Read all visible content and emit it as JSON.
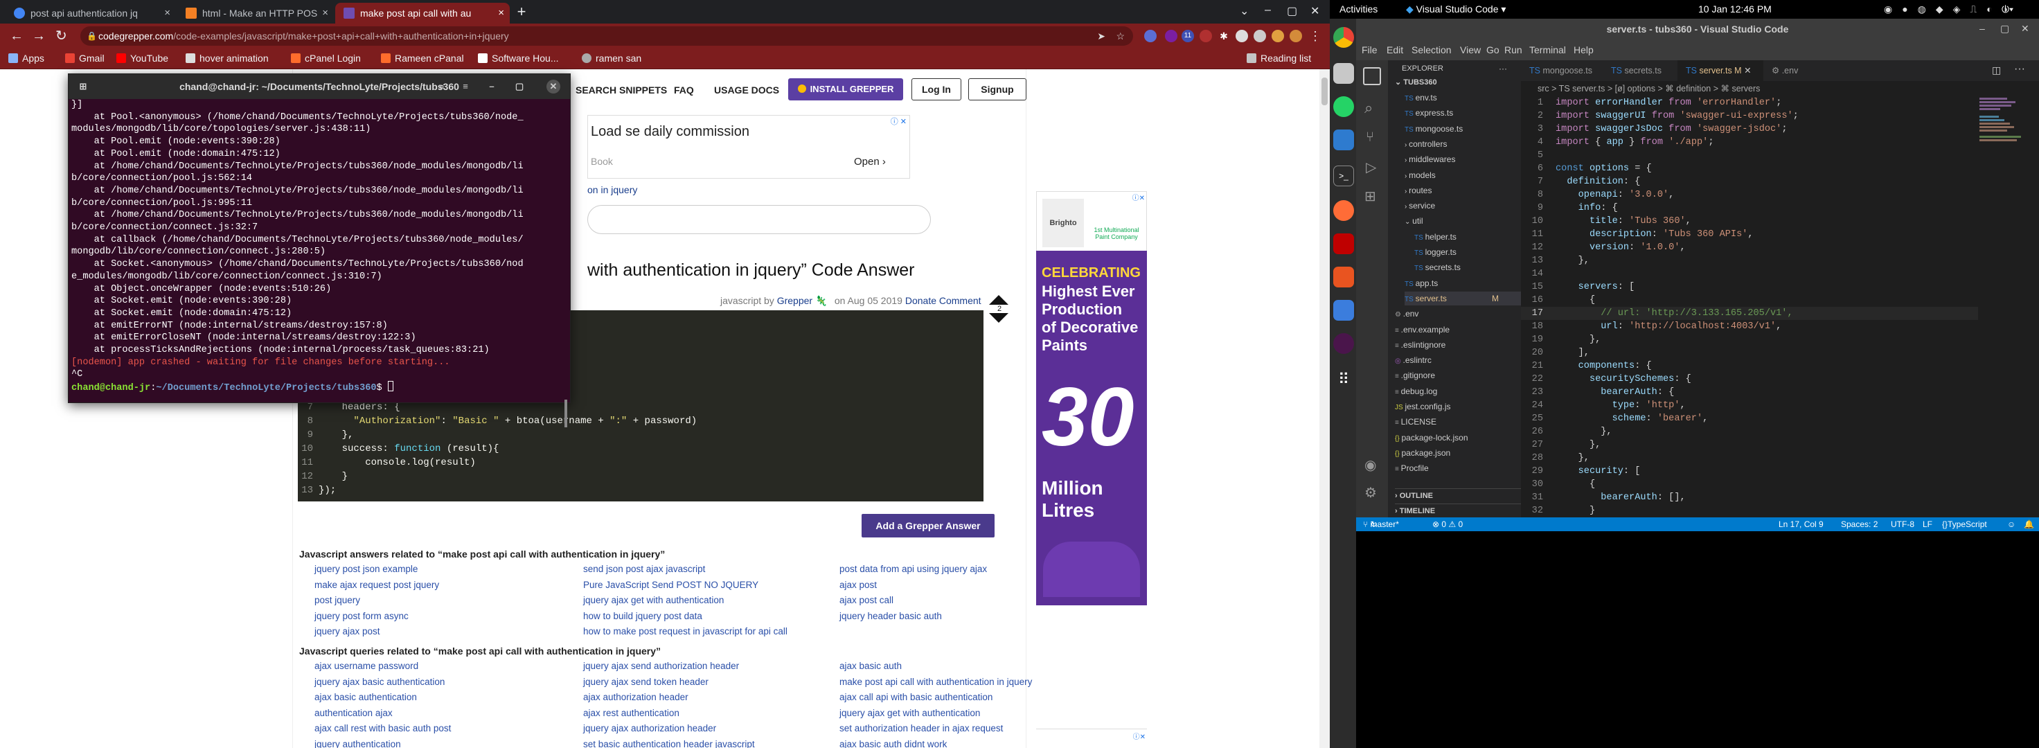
{
  "browser": {
    "tabs": [
      {
        "label": "post api authentication jq"
      },
      {
        "label": "html - Make an HTTP POS"
      },
      {
        "label": "make post api call with au"
      }
    ],
    "url_host": "codegrepper.com",
    "url_path": "/code-examples/javascript/make+post+api+call+with+authentication+in+jquery",
    "bookmarks": [
      "Apps",
      "Gmail",
      "YouTube",
      "hover animation",
      "cPanel Login",
      "Rameen cPanal",
      "Software Hou...",
      "ramen san"
    ],
    "reading_list": "Reading list",
    "ext_badge": "11"
  },
  "page": {
    "nav": [
      "SEARCH SNIPPETS",
      "FAQ",
      "USAGE DOCS"
    ],
    "install_btn": "INSTALL GREPPER",
    "login_btn": "Log In",
    "signup_btn": "Signup",
    "ad_headline": "Load se daily commission",
    "ad_source": "Book",
    "ad_open": "Open",
    "breadcrumb_tail": "on in jquery",
    "answer_title": "with authentication in jquery” Code Answer",
    "meta_prefix": "javascript by",
    "meta_author": "Grepper",
    "meta_date": "on Aug 05 2019",
    "meta_donate": "Donate Comment",
    "vote_count": "2",
    "code_lines": [
      {
        "n": "7",
        "parts": [
          {
            "t": "    headers: {",
            "c": "p"
          }
        ]
      },
      {
        "n": "8",
        "parts": [
          {
            "t": "      ",
            "c": "p"
          },
          {
            "t": "\"Authorization\"",
            "c": "s"
          },
          {
            "t": ": ",
            "c": "p"
          },
          {
            "t": "\"Basic \"",
            "c": "s"
          },
          {
            "t": " + btoa(username + ",
            "c": "p"
          },
          {
            "t": "\":\"",
            "c": "s"
          },
          {
            "t": " + password)",
            "c": "p"
          }
        ]
      },
      {
        "n": "9",
        "parts": [
          {
            "t": "    },",
            "c": "p"
          }
        ]
      },
      {
        "n": "10",
        "parts": [
          {
            "t": "    success: ",
            "c": "p"
          },
          {
            "t": "function",
            "c": "k"
          },
          {
            "t": " (result){",
            "c": "p"
          }
        ]
      },
      {
        "n": "11",
        "parts": [
          {
            "t": "        console.log(result)",
            "c": "p"
          }
        ]
      },
      {
        "n": "12",
        "parts": [
          {
            "t": "    }",
            "c": "p"
          }
        ]
      },
      {
        "n": "13",
        "parts": [
          {
            "t": "});",
            "c": "p"
          }
        ]
      }
    ],
    "add_answer_btn": "Add a Grepper Answer",
    "answers_title": "Javascript answers related to “make post api call with authentication in jquery”",
    "answers": [
      [
        "jquery post json example",
        "send json post ajax javascript",
        "post data from api using jquery ajax"
      ],
      [
        "make ajax request post jquery",
        "Pure JavaScript Send POST NO JQUERY",
        "ajax post"
      ],
      [
        "post jquery",
        "jquery ajax get with authentication",
        "ajax post call"
      ],
      [
        "jquery post form async",
        "how to build jquery post data",
        "jquery header basic auth"
      ],
      [
        "jquery ajax post",
        "how to make post request in javascript for api call",
        ""
      ]
    ],
    "queries_title": "Javascript queries related to “make post api call with authentication in jquery”",
    "queries": [
      [
        "ajax username password",
        "jquery ajax send authorization header",
        "ajax basic auth"
      ],
      [
        "jquery ajax basic authentication",
        "jquery ajax send token header",
        "make post api call with authentication in jquery"
      ],
      [
        "ajax basic authentication",
        "ajax authorization header",
        "ajax call api with basic authentication"
      ],
      [
        "authentication ajax",
        "ajax rest authentication",
        "jquery ajax get with authentication"
      ],
      [
        "ajax call rest with basic auth post",
        "jquery ajax authorization header",
        "set authorization header in ajax request"
      ],
      [
        "jquery authentication",
        "set basic authentication header javascript",
        "ajax basic auth didnt work"
      ]
    ],
    "side_ad_text": "Brighto",
    "side_ad_badge": "1st Multinational Paint Company",
    "big_ad_lines": [
      "CELEBRATING",
      "Highest Ever",
      "Production",
      "of Decorative",
      "Paints",
      "30",
      "Million",
      "Litres"
    ]
  },
  "terminal": {
    "title": "chand@chand-jr: ~/Documents/TechnoLyte/Projects/tubs360",
    "lines": [
      "}]",
      "    at Pool.<anonymous> (/home/chand/Documents/TechnoLyte/Projects/tubs360/node_",
      "modules/mongodb/lib/core/topologies/server.js:438:11)",
      "    at Pool.emit (node:events:390:28)",
      "    at Pool.emit (node:domain:475:12)",
      "    at /home/chand/Documents/TechnoLyte/Projects/tubs360/node_modules/mongodb/li",
      "b/core/connection/pool.js:562:14",
      "    at /home/chand/Documents/TechnoLyte/Projects/tubs360/node_modules/mongodb/li",
      "b/core/connection/pool.js:995:11",
      "    at /home/chand/Documents/TechnoLyte/Projects/tubs360/node_modules/mongodb/li",
      "b/core/connection/connect.js:32:7",
      "    at callback (/home/chand/Documents/TechnoLyte/Projects/tubs360/node_modules/",
      "mongodb/lib/core/connection/connect.js:280:5)",
      "    at Socket.<anonymous> (/home/chand/Documents/TechnoLyte/Projects/tubs360/nod",
      "e_modules/mongodb/lib/core/connection/connect.js:310:7)",
      "    at Object.onceWrapper (node:events:510:26)",
      "    at Socket.emit (node:events:390:28)",
      "    at Socket.emit (node:domain:475:12)",
      "    at emitErrorNT (node:internal/streams/destroy:157:8)",
      "    at emitErrorCloseNT (node:internal/streams/destroy:122:3)",
      "    at processTicksAndRejections (node:internal/process/task_queues:83:21)"
    ],
    "crash_line": "[nodemon] app crashed - waiting for file changes before starting...",
    "ctrl_c": "^C",
    "prompt_user": "chand@chand-jr",
    "prompt_path": "~/Documents/TechnoLyte/Projects/tubs360",
    "prompt_sym": "$ "
  },
  "ubuntu": {
    "activities": "Activities",
    "app_name": "Visual Studio Code",
    "clock": "10 Jan  12:46 PM"
  },
  "vscode": {
    "title": "server.ts - tubs360 - Visual Studio Code",
    "menu": [
      "File",
      "Edit",
      "Selection",
      "View",
      "Go",
      "Run",
      "Terminal",
      "Help"
    ],
    "explorer_label": "EXPLORER",
    "root": "TUBS360",
    "tree": [
      {
        "label": "env.ts",
        "kind": "ts",
        "depth": 1
      },
      {
        "label": "express.ts",
        "kind": "ts",
        "depth": 1
      },
      {
        "label": "mongoose.ts",
        "kind": "ts",
        "depth": 1
      },
      {
        "label": "controllers",
        "kind": "dir",
        "depth": 1
      },
      {
        "label": "middlewares",
        "kind": "dir",
        "depth": 1
      },
      {
        "label": "models",
        "kind": "dir",
        "depth": 1
      },
      {
        "label": "routes",
        "kind": "dir",
        "depth": 1
      },
      {
        "label": "service",
        "kind": "dir",
        "depth": 1
      },
      {
        "label": "util",
        "kind": "diropen",
        "depth": 1
      },
      {
        "label": "helper.ts",
        "kind": "ts",
        "depth": 2
      },
      {
        "label": "logger.ts",
        "kind": "ts",
        "depth": 2
      },
      {
        "label": "secrets.ts",
        "kind": "ts",
        "depth": 2
      },
      {
        "label": "app.ts",
        "kind": "ts",
        "depth": 1
      },
      {
        "label": "server.ts",
        "kind": "ts",
        "depth": 1,
        "mod": "M"
      },
      {
        "label": ".env",
        "kind": "gear",
        "depth": 0
      },
      {
        "label": ".env.example",
        "kind": "file",
        "depth": 0
      },
      {
        "label": ".eslintignore",
        "kind": "file",
        "depth": 0
      },
      {
        "label": ".eslintrc",
        "kind": "eslint",
        "depth": 0
      },
      {
        "label": ".gitignore",
        "kind": "file",
        "depth": 0
      },
      {
        "label": "debug.log",
        "kind": "file",
        "depth": 0
      },
      {
        "label": "jest.config.js",
        "kind": "js",
        "depth": 0
      },
      {
        "label": "LICENSE",
        "kind": "file",
        "depth": 0
      },
      {
        "label": "package-lock.json",
        "kind": "json",
        "depth": 0
      },
      {
        "label": "package.json",
        "kind": "json",
        "depth": 0
      },
      {
        "label": "Procfile",
        "kind": "file",
        "depth": 0
      }
    ],
    "outline": "OUTLINE",
    "timeline": "TIMELINE",
    "tabs": [
      {
        "label": "mongoose.ts"
      },
      {
        "label": "secrets.ts"
      },
      {
        "label": "server.ts M"
      },
      {
        "label": ".env"
      }
    ],
    "breadcrumb": "src  >  TS server.ts  >  [ø] options  >  ⌘ definition  >  ⌘ servers",
    "code": [
      [
        {
          "t": "import ",
          "c": "kw"
        },
        {
          "t": "errorHandler ",
          "c": "id"
        },
        {
          "t": "from ",
          "c": "kw"
        },
        {
          "t": "'errorHandler'",
          "c": "str"
        },
        {
          "t": ";",
          "c": "p"
        }
      ],
      [
        {
          "t": "import ",
          "c": "kw"
        },
        {
          "t": "swaggerUI ",
          "c": "id"
        },
        {
          "t": "from ",
          "c": "kw"
        },
        {
          "t": "'swagger-ui-express'",
          "c": "str"
        },
        {
          "t": ";",
          "c": "p"
        }
      ],
      [
        {
          "t": "import ",
          "c": "kw"
        },
        {
          "t": "swaggerJsDoc ",
          "c": "id"
        },
        {
          "t": "from ",
          "c": "kw"
        },
        {
          "t": "'swagger-jsdoc'",
          "c": "str"
        },
        {
          "t": ";",
          "c": "p"
        }
      ],
      [
        {
          "t": "import ",
          "c": "kw"
        },
        {
          "t": "{ ",
          "c": "p"
        },
        {
          "t": "app ",
          "c": "id"
        },
        {
          "t": "} ",
          "c": "p"
        },
        {
          "t": "from ",
          "c": "kw"
        },
        {
          "t": "'./app'",
          "c": "str"
        },
        {
          "t": ";",
          "c": "p"
        }
      ],
      [],
      [
        {
          "t": "const ",
          "c": "k2"
        },
        {
          "t": "options ",
          "c": "id"
        },
        {
          "t": "= {",
          "c": "p"
        }
      ],
      [
        {
          "t": "  definition",
          "c": "id"
        },
        {
          "t": ": {",
          "c": "p"
        }
      ],
      [
        {
          "t": "    openapi",
          "c": "id"
        },
        {
          "t": ": ",
          "c": "p"
        },
        {
          "t": "'3.0.0'",
          "c": "str"
        },
        {
          "t": ",",
          "c": "p"
        }
      ],
      [
        {
          "t": "    info",
          "c": "id"
        },
        {
          "t": ": {",
          "c": "p"
        }
      ],
      [
        {
          "t": "      title",
          "c": "id"
        },
        {
          "t": ": ",
          "c": "p"
        },
        {
          "t": "'Tubs 360'",
          "c": "str"
        },
        {
          "t": ",",
          "c": "p"
        }
      ],
      [
        {
          "t": "      description",
          "c": "id"
        },
        {
          "t": ": ",
          "c": "p"
        },
        {
          "t": "'Tubs 360 APIs'",
          "c": "str"
        },
        {
          "t": ",",
          "c": "p"
        }
      ],
      [
        {
          "t": "      version",
          "c": "id"
        },
        {
          "t": ": ",
          "c": "p"
        },
        {
          "t": "'1.0.0'",
          "c": "str"
        },
        {
          "t": ",",
          "c": "p"
        }
      ],
      [
        {
          "t": "    },",
          "c": "p"
        }
      ],
      [],
      [
        {
          "t": "    servers",
          "c": "id"
        },
        {
          "t": ": [",
          "c": "p"
        }
      ],
      [
        {
          "t": "      {",
          "c": "p"
        }
      ],
      [
        {
          "t": "        // url: 'http://3.133.165.205/v1',",
          "c": "cm"
        }
      ],
      [
        {
          "t": "        url",
          "c": "id"
        },
        {
          "t": ": ",
          "c": "p"
        },
        {
          "t": "'http://localhost:4003/v1'",
          "c": "str"
        },
        {
          "t": ",",
          "c": "p"
        }
      ],
      [
        {
          "t": "      },",
          "c": "p"
        }
      ],
      [
        {
          "t": "    ],",
          "c": "p"
        }
      ],
      [
        {
          "t": "    components",
          "c": "id"
        },
        {
          "t": ": {",
          "c": "p"
        }
      ],
      [
        {
          "t": "      securitySchemes",
          "c": "id"
        },
        {
          "t": ": {",
          "c": "p"
        }
      ],
      [
        {
          "t": "        bearerAuth",
          "c": "id"
        },
        {
          "t": ": {",
          "c": "p"
        }
      ],
      [
        {
          "t": "          type",
          "c": "id"
        },
        {
          "t": ": ",
          "c": "p"
        },
        {
          "t": "'http'",
          "c": "str"
        },
        {
          "t": ",",
          "c": "p"
        }
      ],
      [
        {
          "t": "          scheme",
          "c": "id"
        },
        {
          "t": ": ",
          "c": "p"
        },
        {
          "t": "'bearer'",
          "c": "str"
        },
        {
          "t": ",",
          "c": "p"
        }
      ],
      [
        {
          "t": "        },",
          "c": "p"
        }
      ],
      [
        {
          "t": "      },",
          "c": "p"
        }
      ],
      [
        {
          "t": "    },",
          "c": "p"
        }
      ],
      [
        {
          "t": "    security",
          "c": "id"
        },
        {
          "t": ": [",
          "c": "p"
        }
      ],
      [
        {
          "t": "      {",
          "c": "p"
        }
      ],
      [
        {
          "t": "        bearerAuth",
          "c": "id"
        },
        {
          "t": ": ",
          "c": "p"
        },
        {
          "t": "[]",
          "c": "p"
        },
        {
          "t": ",",
          "c": "p"
        }
      ],
      [
        {
          "t": "      }",
          "c": "p"
        }
      ]
    ],
    "status": {
      "branch": "master*",
      "problems": "⊗ 0 ⚠ 0",
      "position": "Ln 17, Col 9",
      "spaces": "Spaces: 2",
      "encoding": "UTF-8",
      "eol": "LF",
      "language": "TypeScript"
    }
  }
}
